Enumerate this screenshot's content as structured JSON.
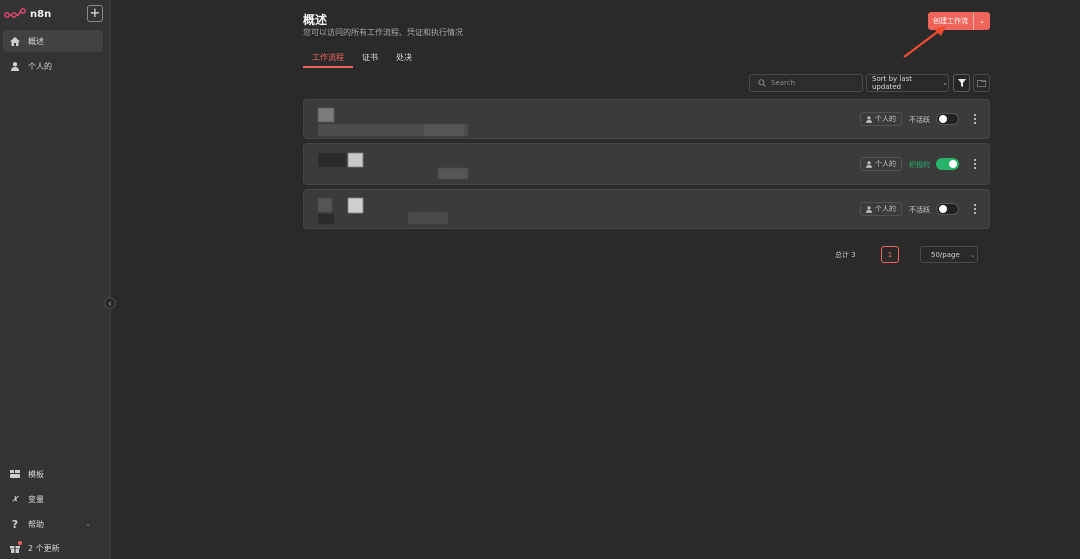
{
  "sidebar": {
    "logo_text": "n8n",
    "add_label": "+",
    "nav": [
      {
        "label": "概述",
        "icon": "home-icon",
        "active": true
      },
      {
        "label": "个人的",
        "icon": "user-icon",
        "active": false
      }
    ],
    "bottom": [
      {
        "label": "模板",
        "icon": "templates-icon"
      },
      {
        "label": "变量",
        "icon": "variables-icon"
      },
      {
        "label": "帮助",
        "icon": "help-icon"
      },
      {
        "label": "2 个更新",
        "icon": "gift-icon"
      }
    ]
  },
  "header": {
    "title": "概述",
    "subtitle": "您可以访问的所有工作流程、凭证和执行情况",
    "create_button": "创建工作流"
  },
  "tabs": [
    {
      "label": "工作流程",
      "active": true
    },
    {
      "label": "证书",
      "active": false
    },
    {
      "label": "处决",
      "active": false
    }
  ],
  "toolbar": {
    "search_placeholder": "Search",
    "sort_label": "Sort by last updated"
  },
  "workflows": [
    {
      "owner": "个人的",
      "status": "不活跃",
      "active": false
    },
    {
      "owner": "个人的",
      "status": "积极的",
      "active": true
    },
    {
      "owner": "个人的",
      "status": "不活跃",
      "active": false
    }
  ],
  "pagination": {
    "total": "总计 3",
    "current_page": "1",
    "per_page": "50/page"
  },
  "colors": {
    "accent": "#f0655b",
    "active_green": "#25b56a",
    "background": "#2a2a2a",
    "sidebar": "#333333"
  }
}
